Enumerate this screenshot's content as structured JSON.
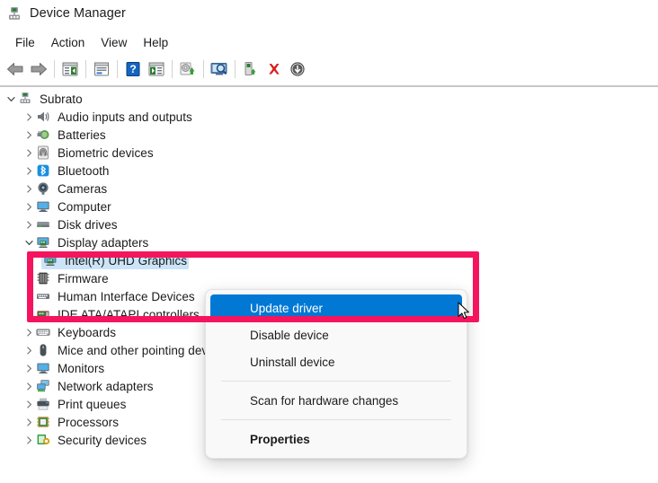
{
  "window": {
    "title": "Device Manager",
    "title_icon": "device-manager-icon"
  },
  "menubar": {
    "items": [
      {
        "label": "File",
        "name": "menu-file"
      },
      {
        "label": "Action",
        "name": "menu-action"
      },
      {
        "label": "View",
        "name": "menu-view"
      },
      {
        "label": "Help",
        "name": "menu-help"
      }
    ]
  },
  "toolbar": {
    "buttons": [
      {
        "icon": "back-arrow-icon",
        "name": "toolbar-back"
      },
      {
        "icon": "forward-arrow-icon",
        "name": "toolbar-forward"
      },
      {
        "icon": "show-hide-console-tree-icon",
        "name": "toolbar-console-tree"
      },
      {
        "icon": "properties-window-icon",
        "name": "toolbar-properties"
      },
      {
        "icon": "help-icon",
        "name": "toolbar-help"
      },
      {
        "icon": "show-hide-action-pane-icon",
        "name": "toolbar-action-pane"
      },
      {
        "icon": "update-driver-icon",
        "name": "toolbar-update-driver"
      },
      {
        "icon": "scan-hardware-changes-icon",
        "name": "toolbar-scan-hardware"
      },
      {
        "icon": "enable-device-icon",
        "name": "toolbar-enable-device"
      },
      {
        "icon": "uninstall-device-icon",
        "name": "toolbar-uninstall-device"
      },
      {
        "icon": "disable-device-icon",
        "name": "toolbar-disable-device"
      }
    ]
  },
  "tree": {
    "nodes": [
      {
        "label": "Subrato",
        "level": 0,
        "expander": "down",
        "icon": "computer-root-icon",
        "selected": false,
        "name": "tree-node-subrato"
      },
      {
        "label": "Audio inputs and outputs",
        "level": 1,
        "expander": "right",
        "icon": "speaker-icon",
        "selected": false,
        "name": "tree-node-audio-inputs-and-outputs"
      },
      {
        "label": "Batteries",
        "level": 1,
        "expander": "right",
        "icon": "battery-icon",
        "selected": false,
        "name": "tree-node-batteries"
      },
      {
        "label": "Biometric devices",
        "level": 1,
        "expander": "right",
        "icon": "fingerprint-icon",
        "selected": false,
        "name": "tree-node-biometric-devices"
      },
      {
        "label": "Bluetooth",
        "level": 1,
        "expander": "right",
        "icon": "bluetooth-icon",
        "selected": false,
        "name": "tree-node-bluetooth"
      },
      {
        "label": "Cameras",
        "level": 1,
        "expander": "right",
        "icon": "camera-icon",
        "selected": false,
        "name": "tree-node-cameras"
      },
      {
        "label": "Computer",
        "level": 1,
        "expander": "right",
        "icon": "monitor-icon",
        "selected": false,
        "name": "tree-node-computer"
      },
      {
        "label": "Disk drives",
        "level": 1,
        "expander": "right",
        "icon": "disk-drive-icon",
        "selected": false,
        "name": "tree-node-disk-drives"
      },
      {
        "label": "Display adapters",
        "level": 1,
        "expander": "down",
        "icon": "display-adapter-icon",
        "selected": false,
        "name": "tree-node-display-adapters"
      },
      {
        "label": "Intel(R) UHD Graphics",
        "level": 2,
        "expander": "none",
        "icon": "display-adapter-icon",
        "selected": true,
        "name": "tree-node-intel-uhd-graphics"
      },
      {
        "label": "Firmware",
        "level": 1,
        "expander": "right",
        "icon": "firmware-chip-icon",
        "selected": false,
        "name": "tree-node-firmware"
      },
      {
        "label": "Human Interface Devices",
        "level": 1,
        "expander": "right",
        "icon": "hid-icon",
        "selected": false,
        "name": "tree-node-human-interface-devices"
      },
      {
        "label": "IDE ATA/ATAPI controllers",
        "level": 1,
        "expander": "right",
        "icon": "ide-controller-icon",
        "selected": false,
        "name": "tree-node-ide-ata-atapi-controllers"
      },
      {
        "label": "Keyboards",
        "level": 1,
        "expander": "right",
        "icon": "keyboard-icon",
        "selected": false,
        "name": "tree-node-keyboards"
      },
      {
        "label": "Mice and other pointing devices",
        "level": 1,
        "expander": "right",
        "icon": "mouse-icon",
        "selected": false,
        "name": "tree-node-mice-and-other-pointing-devices"
      },
      {
        "label": "Monitors",
        "level": 1,
        "expander": "right",
        "icon": "monitor-icon",
        "selected": false,
        "name": "tree-node-monitors"
      },
      {
        "label": "Network adapters",
        "level": 1,
        "expander": "right",
        "icon": "network-adapter-icon",
        "selected": false,
        "name": "tree-node-network-adapters"
      },
      {
        "label": "Print queues",
        "level": 1,
        "expander": "right",
        "icon": "printer-icon",
        "selected": false,
        "name": "tree-node-print-queues"
      },
      {
        "label": "Processors",
        "level": 1,
        "expander": "right",
        "icon": "processor-icon",
        "selected": false,
        "name": "tree-node-processors"
      },
      {
        "label": "Security devices",
        "level": 1,
        "expander": "right",
        "icon": "security-device-icon",
        "selected": false,
        "name": "tree-node-security-devices"
      }
    ]
  },
  "context_menu": {
    "items": [
      {
        "label": "Update driver",
        "type": "item",
        "highlighted": true,
        "bold": false,
        "name": "context-menu-update-driver"
      },
      {
        "label": "Disable device",
        "type": "item",
        "highlighted": false,
        "bold": false,
        "name": "context-menu-disable-device"
      },
      {
        "label": "Uninstall device",
        "type": "item",
        "highlighted": false,
        "bold": false,
        "name": "context-menu-uninstall-device"
      },
      {
        "label": "",
        "type": "separator",
        "highlighted": false,
        "bold": false,
        "name": "context-menu-separator-1"
      },
      {
        "label": "Scan for hardware changes",
        "type": "item",
        "highlighted": false,
        "bold": false,
        "name": "context-menu-scan-for-hardware-changes"
      },
      {
        "label": "",
        "type": "separator",
        "highlighted": false,
        "bold": false,
        "name": "context-menu-separator-2"
      },
      {
        "label": "Properties",
        "type": "item",
        "highlighted": false,
        "bold": true,
        "name": "context-menu-properties"
      }
    ]
  },
  "annotation": {
    "rect_color": "#f5145e"
  },
  "colors": {
    "accent_blue": "#0078d4",
    "selection_blue": "#cce4f7",
    "annotation_pink": "#f5145e",
    "window_bg": "#ffffff",
    "menu_bg": "#f9f9f9"
  }
}
